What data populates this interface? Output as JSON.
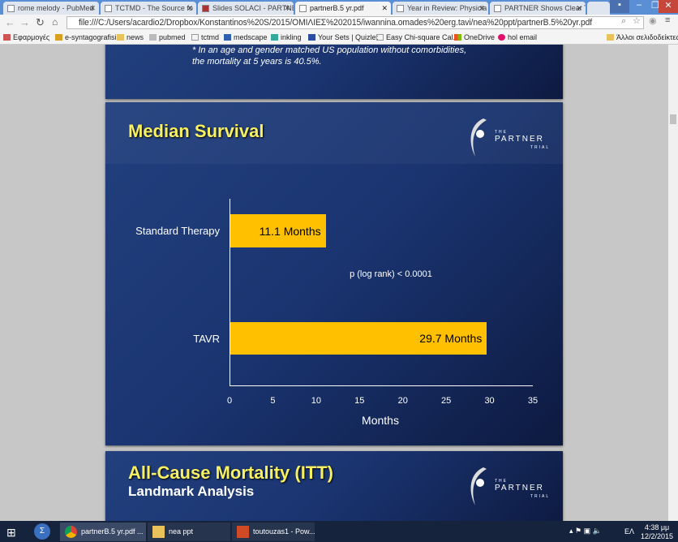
{
  "browser": {
    "tabs": [
      {
        "title": "rome melody - PubMed"
      },
      {
        "title": "TCTMD - The Source fo"
      },
      {
        "title": "Slides SOLACI - PARTNE"
      },
      {
        "title": "partnerB.5 yr.pdf",
        "active": true
      },
      {
        "title": "Year in Review: Physicia"
      },
      {
        "title": "PARTNER Shows Clear T"
      }
    ],
    "url": "file:///C:/Users/acardio2/Dropbox/Konstantinos%20S/2015/ΟΜΙΛΙΕΣ%202015/iwannina.omades%20erg.tavi/nea%20ppt/partnerB.5%20yr.pdf",
    "bookmarks": [
      {
        "label": "Εφαρμογές",
        "icon": "apps-icon"
      },
      {
        "label": "e-syntagografisi",
        "icon": "site-icon"
      },
      {
        "label": "news",
        "icon": "folder-icon"
      },
      {
        "label": "pubmed",
        "icon": "pubmed-icon"
      },
      {
        "label": "tctmd",
        "icon": "page-icon"
      },
      {
        "label": "medscape",
        "icon": "medscape-icon"
      },
      {
        "label": "inkling",
        "icon": "inkling-icon"
      },
      {
        "label": "Your Sets | Quizlet",
        "icon": "quizlet-icon"
      },
      {
        "label": "Easy Chi-square Cal...",
        "icon": "page-icon"
      },
      {
        "label": "OneDrive",
        "icon": "windows-icon"
      },
      {
        "label": "hol email",
        "icon": "hol-icon"
      }
    ],
    "other_bookmarks": "Άλλοι σελιδοδείκτες"
  },
  "slides": {
    "prev_note_line1": "* In an age and gender matched US population without comorbidities,",
    "prev_note_line2": "the mortality at 5 years is 40.5%.",
    "logo": {
      "the": "THE",
      "name": "PARTNER",
      "trial": "TRIAL"
    },
    "current_title": "Median Survival",
    "next_title": "All-Cause Mortality (ITT)",
    "next_subtitle": "Landmark Analysis"
  },
  "chart_data": {
    "type": "bar",
    "orientation": "horizontal",
    "categories": [
      "Standard Therapy",
      "TAVR"
    ],
    "values": [
      11.1,
      29.7
    ],
    "data_labels": [
      "11.1 Months",
      "29.7 Months"
    ],
    "xlabel": "Months",
    "xlim": [
      0,
      35
    ],
    "xticks": [
      "0",
      "5",
      "10",
      "15",
      "20",
      "25",
      "30",
      "35"
    ],
    "annotation": "p (log rank) < 0.0001",
    "bar_color": "#ffc000"
  },
  "taskbar": {
    "items": [
      {
        "label": "partnerB.5 yr.pdf ..."
      },
      {
        "label": "nea ppt"
      },
      {
        "label": "toutouzas1 - Pow..."
      }
    ],
    "lang": "ΕΛ",
    "time": "4:38 μμ",
    "date": "12/2/2015"
  }
}
